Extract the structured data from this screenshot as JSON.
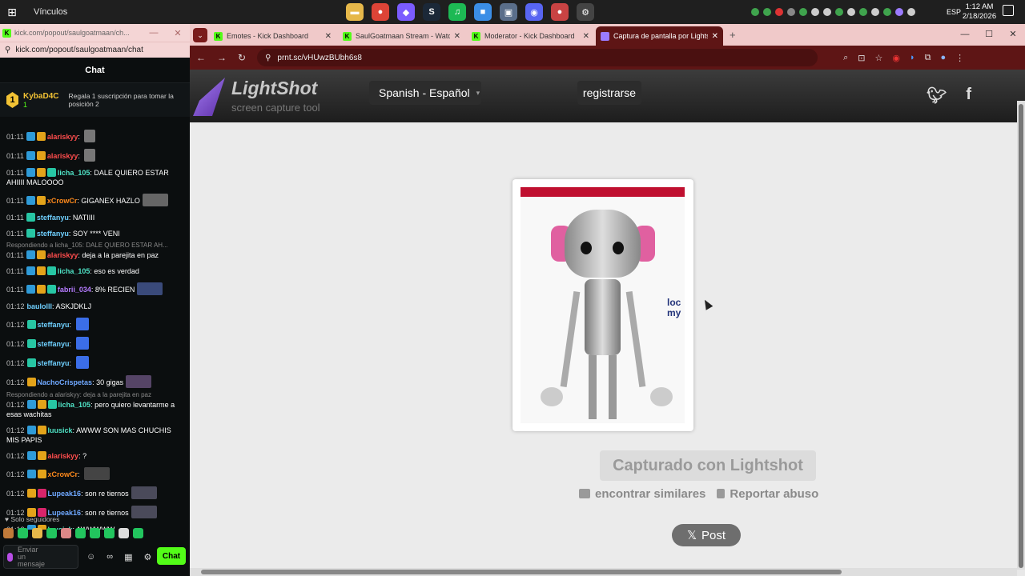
{
  "taskbar": {
    "folder_label": "Vínculos",
    "language": "ESP",
    "time": "1:12 AM",
    "date": "2/18/2026",
    "apps": [
      {
        "name": "file-explorer-icon",
        "glyph": "▬",
        "color": "#e6b84a"
      },
      {
        "name": "chrome-icon",
        "glyph": "●",
        "color": "#dd4437"
      },
      {
        "name": "copilot-icon",
        "glyph": "◆",
        "color": "#7b5cff"
      },
      {
        "name": "steam-icon",
        "glyph": "S",
        "color": "#1b2838"
      },
      {
        "name": "spotify-icon",
        "glyph": "♫",
        "color": "#1db954"
      },
      {
        "name": "store-icon",
        "glyph": "■",
        "color": "#3b8ee6"
      },
      {
        "name": "app-icon",
        "glyph": "▣",
        "color": "#5a6e8a"
      },
      {
        "name": "discord-icon",
        "glyph": "◉",
        "color": "#5865f2"
      },
      {
        "name": "chrome-active-icon",
        "glyph": "●",
        "color": "#c84343"
      },
      {
        "name": "robot-app-icon",
        "glyph": "⚙",
        "color": "#444"
      }
    ]
  },
  "popup": {
    "tab_title": "kick.com/popout/saulgoatmaan/ch...",
    "url": "kick.com/popout/saulgoatmaan/chat",
    "chat_title": "Chat",
    "pinned": {
      "rank": "1",
      "user": "KybaD4C",
      "count": "1",
      "message": "Regala 1 suscripción para tomar la posición 2"
    },
    "messages": [
      {
        "ts": "01:11",
        "badges": [
          "mod",
          "crown"
        ],
        "user": "alariskyy",
        "color": "#ff4d4d",
        "text": "",
        "emote": "#777"
      },
      {
        "ts": "01:11",
        "badges": [
          "mod",
          "crown"
        ],
        "user": "alariskyy",
        "color": "#ff4d4d",
        "text": "",
        "emote": "#777"
      },
      {
        "ts": "01:11",
        "badges": [
          "mod",
          "crown",
          "sub"
        ],
        "user": "licha_105",
        "color": "#4fe3c6",
        "text": "DALE QUIERO ESTAR AHIIII MALOOOO"
      },
      {
        "ts": "01:11",
        "badges": [
          "mod",
          "crown"
        ],
        "user": "xCrowCr",
        "color": "#ff8a1c",
        "text": "GIGANEX HAZLO",
        "emote": "#666"
      },
      {
        "ts": "01:11",
        "badges": [
          "sub"
        ],
        "user": "steffanyu",
        "color": "#6fd0ff",
        "text": "NATIIII"
      },
      {
        "ts": "01:11",
        "badges": [
          "sub"
        ],
        "user": "steffanyu",
        "color": "#6fd0ff",
        "text": "SOY **** VENI"
      },
      {
        "reply": "Respondiendo a licha_105: DALE QUIERO ESTAR AH..."
      },
      {
        "ts": "01:11",
        "badges": [
          "mod",
          "crown"
        ],
        "user": "alariskyy",
        "color": "#ff4d4d",
        "text": "deja a la parejita en paz"
      },
      {
        "ts": "01:11",
        "badges": [
          "mod",
          "crown",
          "sub"
        ],
        "user": "licha_105",
        "color": "#4fe3c6",
        "text": "eso es verdad"
      },
      {
        "ts": "01:11",
        "badges": [
          "mod",
          "crown",
          "sub"
        ],
        "user": "fabrii_034",
        "color": "#b57bff",
        "text": "8% RECIEN",
        "emote": "#3a4a7a"
      },
      {
        "ts": "01:12",
        "badges": [],
        "user": "baulolll",
        "color": "#6fd0ff",
        "text": "ASKJDKLJ"
      },
      {
        "ts": "01:12",
        "badges": [
          "sub"
        ],
        "user": "steffanyu",
        "color": "#6fd0ff",
        "text": "",
        "emote": "#3b6ee8"
      },
      {
        "ts": "01:12",
        "badges": [
          "sub"
        ],
        "user": "steffanyu",
        "color": "#6fd0ff",
        "text": "",
        "emote": "#3b6ee8"
      },
      {
        "ts": "01:12",
        "badges": [
          "sub"
        ],
        "user": "steffanyu",
        "color": "#6fd0ff",
        "text": "",
        "emote": "#3b6ee8"
      },
      {
        "ts": "01:12",
        "badges": [
          "crown"
        ],
        "user": "NachoCrispetas",
        "color": "#6fa8ff",
        "text": "30 gigas",
        "emote": "#554466"
      },
      {
        "reply": "Respondiendo a alariskyy: deja a la parejita en paz"
      },
      {
        "ts": "01:12",
        "badges": [
          "mod",
          "crown",
          "sub"
        ],
        "user": "licha_105",
        "color": "#4fe3c6",
        "text": "pero quiero levantarme a esas wachitas"
      },
      {
        "ts": "01:12",
        "badges": [
          "mod",
          "crown"
        ],
        "user": "luusick",
        "color": "#4fe3c6",
        "text": "AWWW SON MAS CHUCHIS MIS PAPIS"
      },
      {
        "ts": "01:12",
        "badges": [
          "mod",
          "crown"
        ],
        "user": "alariskyy",
        "color": "#ff4d4d",
        "text": "?"
      },
      {
        "ts": "01:12",
        "badges": [
          "mod",
          "crown"
        ],
        "user": "xCrowCr",
        "color": "#ff8a1c",
        "text": "",
        "emote": "#444"
      },
      {
        "ts": "01:12",
        "badges": [
          "crown",
          "og"
        ],
        "user": "Lupeak16",
        "color": "#6fa8ff",
        "text": "son re tiernos",
        "emote": "#4a4a5a"
      },
      {
        "ts": "01:12",
        "badges": [
          "crown",
          "og"
        ],
        "user": "Lupeak16",
        "color": "#6fa8ff",
        "text": "son re tiernos",
        "emote": "#4a4a5a"
      },
      {
        "ts": "01:12",
        "badges": [
          "mod",
          "crown"
        ],
        "user": "luusick",
        "color": "#4fe3c6",
        "text": "AWWWWW"
      }
    ],
    "followers_label": "Solo seguidores",
    "input_placeholder": "Enviar un mensaje",
    "send_label": "Chat"
  },
  "browser": {
    "tabs": [
      {
        "title": "Emotes - Kick Dashboard",
        "active": false
      },
      {
        "title": "SaulGoatmaan Stream - Watch",
        "active": false
      },
      {
        "title": "Moderator - Kick Dashboard",
        "active": false
      },
      {
        "title": "Captura de pantalla por Lightsh",
        "active": true
      }
    ],
    "url": "prnt.sc/vHUwzBUbh6s8"
  },
  "lightshot": {
    "logo_name": "LightShot",
    "logo_sub": "screen capture tool",
    "language_button": "Spanish - Español",
    "register_button": "registrarse",
    "captured_label": "Capturado con Lightshot",
    "find_similar": "encontrar similares",
    "report_abuse": "Reportar abuso",
    "post_button": "Post",
    "image_side_text": "loc\nmy"
  }
}
